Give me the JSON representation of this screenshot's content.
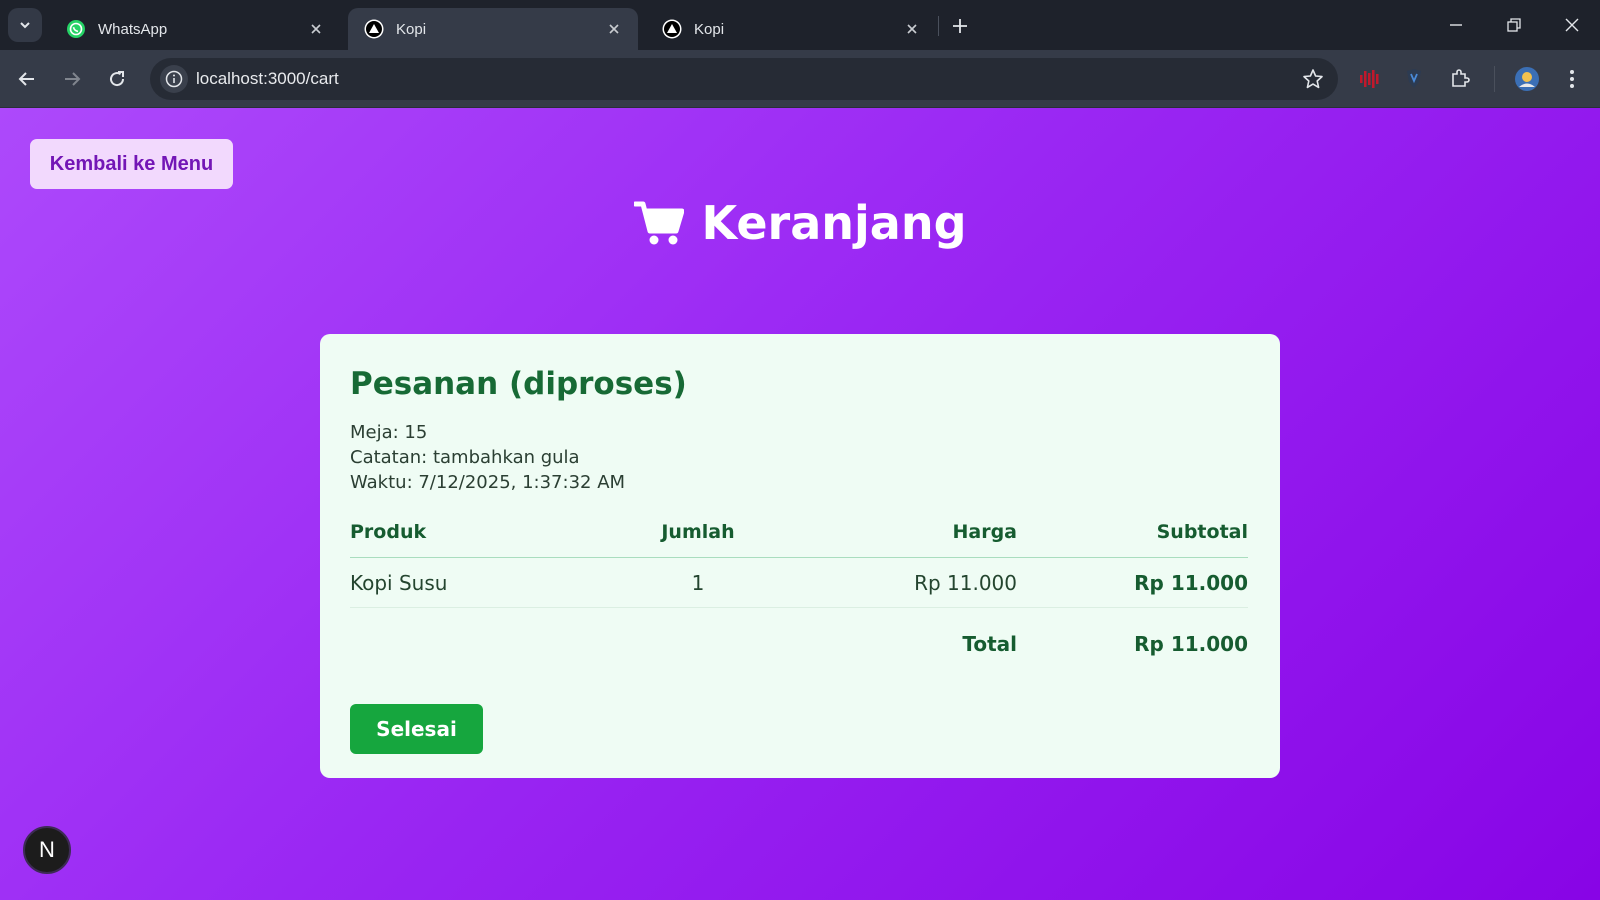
{
  "browser": {
    "tabs": [
      {
        "title": "WhatsApp",
        "icon": "whatsapp-icon",
        "active": false
      },
      {
        "title": "Kopi",
        "icon": "nextjs-triangle-icon",
        "active": true
      },
      {
        "title": "Kopi",
        "icon": "nextjs-triangle-icon",
        "active": false
      }
    ],
    "url": "localhost:3000/cart"
  },
  "page": {
    "back_label": "Kembali ke Menu",
    "title": "Keranjang",
    "title_icon": "shopping-cart-icon",
    "order": {
      "heading": "Pesanan (diproses)",
      "table_line": "Meja: 15",
      "note_line": "Catatan: tambahkan gula",
      "time_line": "Waktu: 7/12/2025, 1:37:32 AM"
    },
    "table": {
      "headers": [
        "Produk",
        "Jumlah",
        "Harga",
        "Subtotal"
      ],
      "rows": [
        {
          "product": "Kopi Susu",
          "qty": "1",
          "price": "Rp 11.000",
          "subtotal": "Rp 11.000"
        }
      ],
      "total_label": "Total",
      "total_value": "Rp 11.000"
    },
    "done_label": "Selesai",
    "dev_badge": "N"
  },
  "colors": {
    "gradient_start": "#ad49fb",
    "gradient_end": "#8804e6",
    "card_bg": "#effcf4",
    "green_text": "#176a35",
    "green_button": "#16a63e",
    "back_button_bg": "#f2d9fd"
  }
}
